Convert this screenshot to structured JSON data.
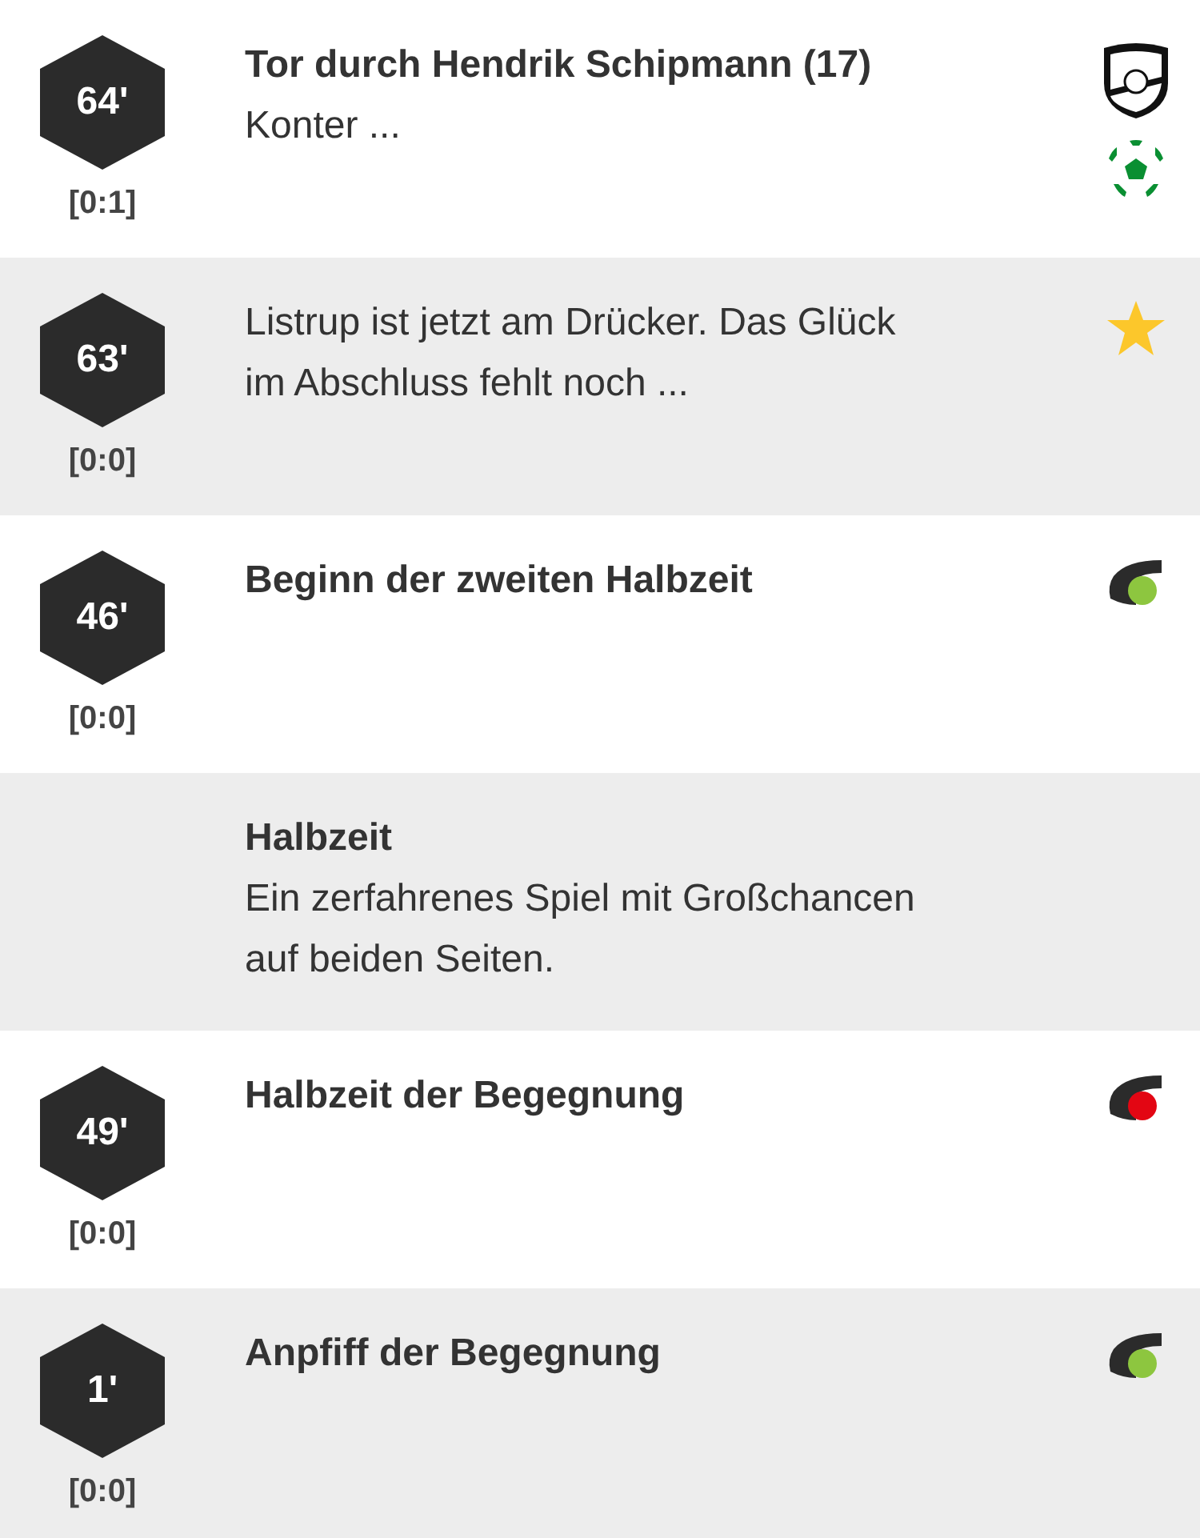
{
  "events": [
    {
      "minute": "64'",
      "score": "[0:1]",
      "title": "Tor durch Hendrik Schipmann (17)",
      "text": "Konter ...",
      "icons": [
        {
          "kind": "crest"
        },
        {
          "kind": "ball"
        }
      ]
    },
    {
      "minute": "63'",
      "score": "[0:0]",
      "text": "Listrup ist jetzt am Drücker. Das Glück im Abschluss fehlt noch ...",
      "icons": [
        {
          "kind": "star"
        }
      ]
    },
    {
      "minute": "46'",
      "score": "[0:0]",
      "title": "Beginn der zweiten Halbzeit",
      "icons": [
        {
          "kind": "whistle",
          "color": "#8dc63f"
        }
      ]
    },
    {
      "title": "Halbzeit",
      "text": "Ein zerfahrenes Spiel mit Großchancen auf beiden Seiten."
    },
    {
      "minute": "49'",
      "score": "[0:0]",
      "title": "Halbzeit der Begegnung",
      "icons": [
        {
          "kind": "whistle",
          "color": "#e30613"
        }
      ]
    },
    {
      "minute": "1'",
      "score": "[0:0]",
      "title": "Anpfiff der Begegnung",
      "icons": [
        {
          "kind": "whistle",
          "color": "#8dc63f"
        }
      ]
    }
  ]
}
